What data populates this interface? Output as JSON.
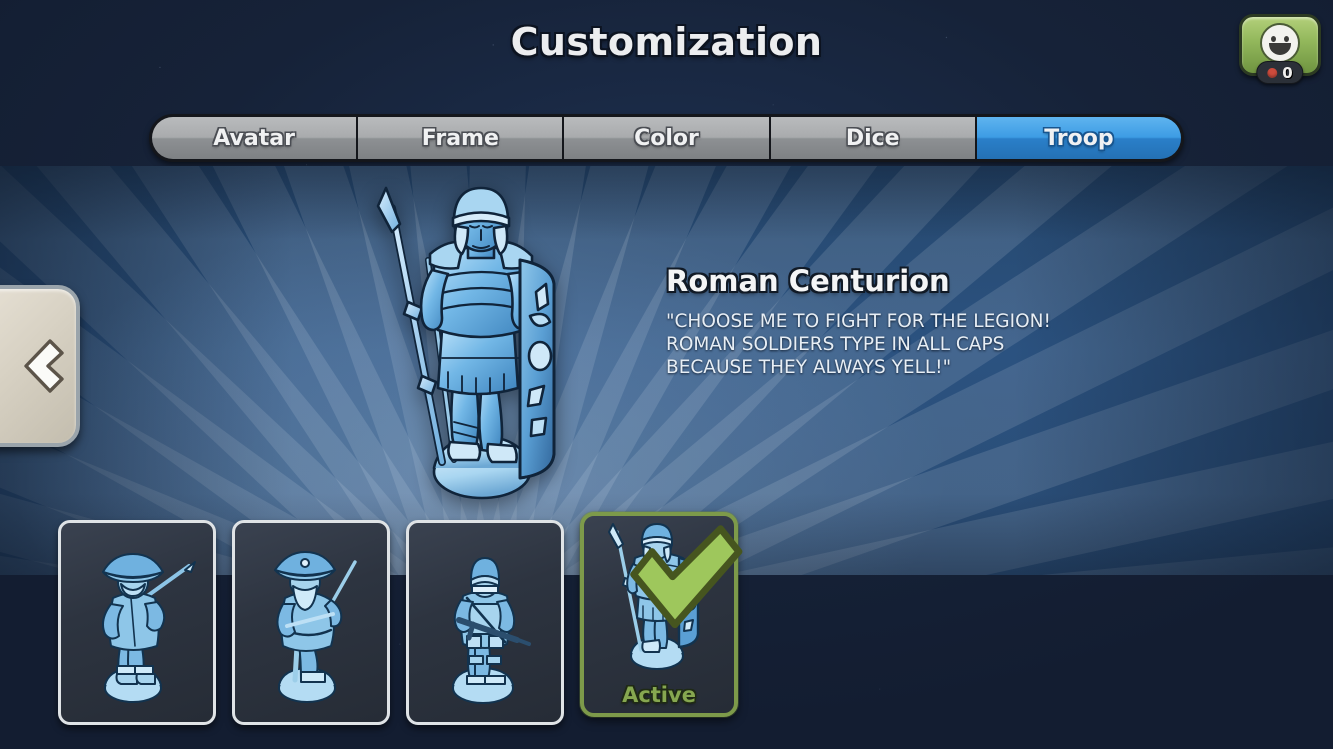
{
  "header": {
    "title": "Customization"
  },
  "profile": {
    "avatar_icon": "smiley-face-icon",
    "notification_dot_color": "#cc4b3c",
    "notification_count": "0",
    "badge_color": "#93b85c"
  },
  "tabs": [
    {
      "label": "Avatar",
      "active": false
    },
    {
      "label": "Frame",
      "active": false
    },
    {
      "label": "Color",
      "active": false
    },
    {
      "label": "Dice",
      "active": false
    },
    {
      "label": "Troop",
      "active": true
    }
  ],
  "active_tab_color": "#3d9ce4",
  "navigation": {
    "back_label": "",
    "back_icon": "chevron-left-icon"
  },
  "showcase": {
    "troop_name": "Roman Centurion",
    "troop_description": "\"CHOOSE ME TO FIGHT FOR THE LEGION! ROMAN SOLDIERS TYPE IN ALL CAPS BECAUSE THEY ALWAYS YELL!\"",
    "figure_icon": "roman-centurion-figurine",
    "panel_color": "#2b5280"
  },
  "thumbnails": [
    {
      "figure_icon": "musketeer-figurine",
      "selected": false,
      "status_label": ""
    },
    {
      "figure_icon": "pirate-captain-figurine",
      "selected": false,
      "status_label": ""
    },
    {
      "figure_icon": "modern-soldier-figurine",
      "selected": false,
      "status_label": ""
    },
    {
      "figure_icon": "roman-centurion-figurine",
      "selected": true,
      "status_label": "Active"
    }
  ],
  "selected": {
    "status_label": "Active",
    "check_icon": "check-mark-icon",
    "accent_color": "#7d9a4a"
  }
}
